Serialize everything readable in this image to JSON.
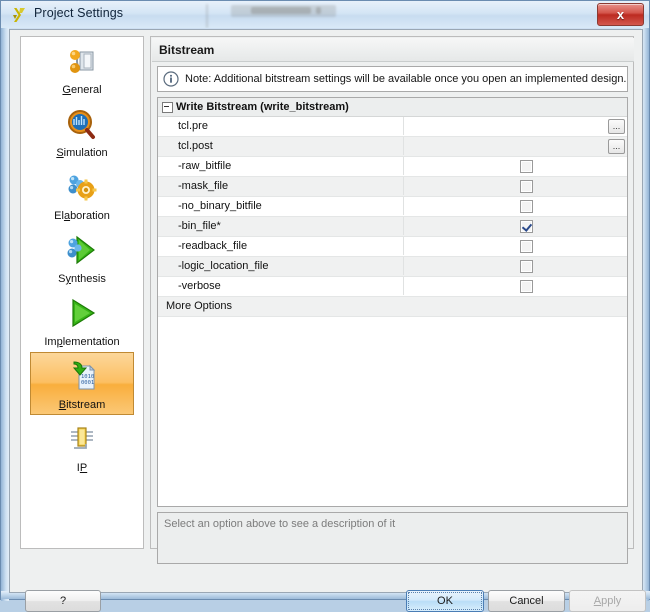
{
  "window": {
    "title": "Project Settings",
    "logo_icon": "xilinx-vivado-logo-icon",
    "close_label": "x"
  },
  "sidebar": {
    "items": [
      {
        "label": "General",
        "mnemonic": "G",
        "icon": "general-gear-icon",
        "selected": false
      },
      {
        "label": "Simulation",
        "mnemonic": "S",
        "icon": "simulation-waveform-magnifier-icon",
        "selected": false
      },
      {
        "label": "Elaboration",
        "mnemonic": "E",
        "icon": "elaboration-gear-molecule-icon",
        "selected": false
      },
      {
        "label": "Synthesis",
        "mnemonic": "y",
        "icon": "synthesis-green-arrow-molecule-icon",
        "selected": false
      },
      {
        "label": "Implementation",
        "mnemonic": "p",
        "icon": "implementation-green-arrow-icon",
        "selected": false
      },
      {
        "label": "Bitstream",
        "mnemonic": "B",
        "icon": "bitstream-file-download-icon",
        "selected": true
      },
      {
        "label": "IP",
        "mnemonic": "P",
        "icon": "ip-chip-icon",
        "selected": false
      }
    ]
  },
  "main": {
    "panel_title": "Bitstream",
    "note": {
      "icon": "info-icon",
      "text": "Note: Additional bitstream settings will be available once you open an implemented design."
    },
    "grid": {
      "group_header": "Write Bitstream (write_bitstream)",
      "group_expanded": true,
      "rows": [
        {
          "name": "tcl.pre",
          "type": "text",
          "value": "",
          "browse": "..."
        },
        {
          "name": "tcl.post",
          "type": "text",
          "value": "",
          "browse": "..."
        },
        {
          "name": "-raw_bitfile",
          "type": "checkbox",
          "checked": false
        },
        {
          "name": "-mask_file",
          "type": "checkbox",
          "checked": false
        },
        {
          "name": "-no_binary_bitfile",
          "type": "checkbox",
          "checked": false
        },
        {
          "name": "-bin_file*",
          "type": "checkbox",
          "checked": true
        },
        {
          "name": "-readback_file",
          "type": "checkbox",
          "checked": false
        },
        {
          "name": "-logic_location_file",
          "type": "checkbox",
          "checked": false
        },
        {
          "name": "-verbose",
          "type": "checkbox",
          "checked": false
        },
        {
          "name": "More Options",
          "type": "label"
        }
      ]
    },
    "description_placeholder": "Select an option above to see a description of it"
  },
  "footer": {
    "help_label": "?",
    "ok_label": "OK",
    "cancel_label": "Cancel",
    "apply_label": "Apply",
    "apply_mnemonic": "A",
    "apply_disabled": true,
    "ok_focused": true
  },
  "colors": {
    "selection_orange": "#f9ae3d",
    "title_gradient_top": "#e8f1fa",
    "close_red": "#bc2a20",
    "checkbox_check": "#2b4a8b",
    "description_text": "#7c7c7c"
  }
}
